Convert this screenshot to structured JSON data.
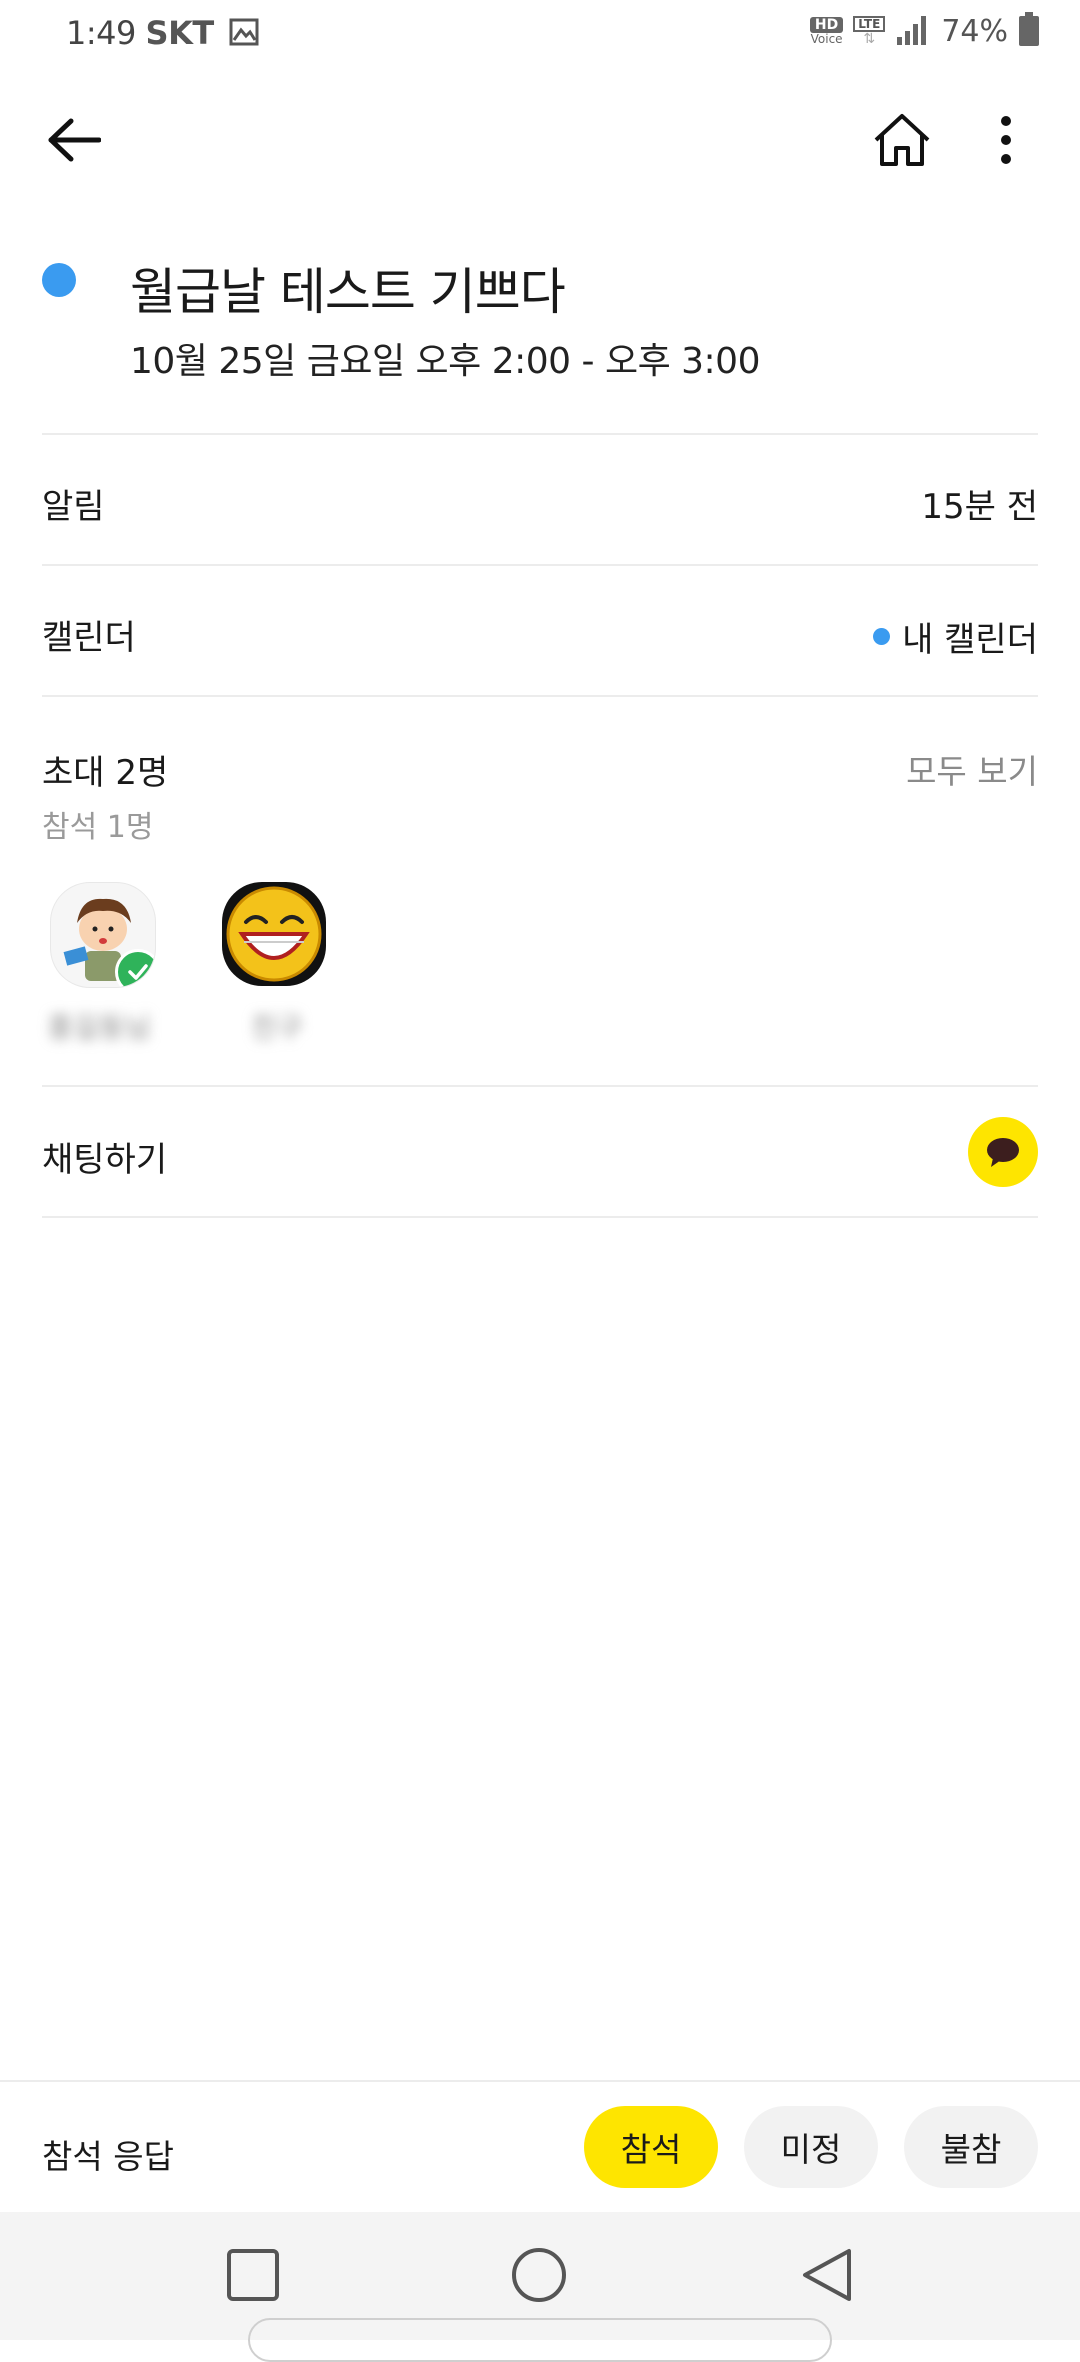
{
  "status_bar": {
    "time": "1:49",
    "carrier": "SKT",
    "hd_label": "HD",
    "voice_label": "Voice",
    "lte_label": "LTE",
    "battery_percent": "74%"
  },
  "event": {
    "title": "월급날 테스트 기쁘다",
    "datetime": "10월 25일 금요일  오후 2:00 - 오후 3:00",
    "color": "#3a9bf0"
  },
  "alarm": {
    "label": "알림",
    "value": "15분 전"
  },
  "calendar": {
    "label": "캘린더",
    "value": "내 캘린더",
    "color": "#3a9bf0"
  },
  "invite": {
    "title": "초대 2명",
    "subtitle": "참석 1명",
    "see_all": "모두 보기",
    "attendees": [
      {
        "name": "홍길동님",
        "attending": true
      },
      {
        "name": "친구"
      }
    ]
  },
  "chat": {
    "label": "채팅하기",
    "accent": "#fee500"
  },
  "response": {
    "label": "참석 응답",
    "attend": "참석",
    "maybe": "미정",
    "decline": "불참"
  }
}
